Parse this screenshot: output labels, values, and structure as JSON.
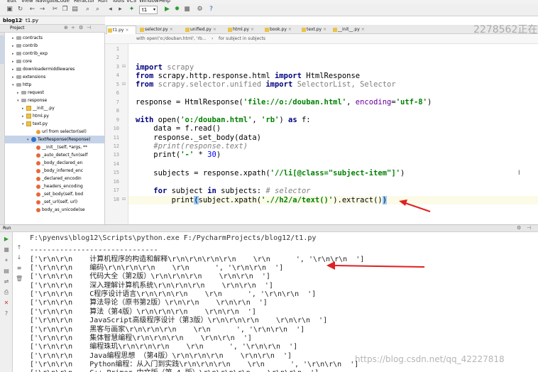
{
  "menu": [
    "Edit",
    "View",
    "Navigate",
    "Code",
    "Refactor",
    "Run",
    "Tools",
    "VCS",
    "Window",
    "Help"
  ],
  "toolbar": {
    "run_config": "t1"
  },
  "breadcrumb": [
    "blog12",
    "t1.py"
  ],
  "project_panel": {
    "title": "Project"
  },
  "tree": [
    {
      "label": "contracts",
      "kind": "folder",
      "indent": 2,
      "arrow": "▸"
    },
    {
      "label": "contrib",
      "kind": "folder",
      "indent": 2,
      "arrow": "▸"
    },
    {
      "label": "contrib_exp",
      "kind": "folder",
      "indent": 2,
      "arrow": "▸"
    },
    {
      "label": "core",
      "kind": "folder",
      "indent": 2,
      "arrow": "▸"
    },
    {
      "label": "downloadermiddlewares",
      "kind": "folder",
      "indent": 2,
      "arrow": "▸"
    },
    {
      "label": "extensions",
      "kind": "folder",
      "indent": 2,
      "arrow": "▸"
    },
    {
      "label": "http",
      "kind": "folder",
      "indent": 2,
      "arrow": "▾"
    },
    {
      "label": "request",
      "kind": "folder",
      "indent": 3,
      "arrow": "▸"
    },
    {
      "label": "response",
      "kind": "folder",
      "indent": 3,
      "arrow": "▾"
    },
    {
      "label": "__init__.py",
      "kind": "py",
      "indent": 4,
      "arrow": "▸"
    },
    {
      "label": "html.py",
      "kind": "py",
      "indent": 4,
      "arrow": "▸"
    },
    {
      "label": "text.py",
      "kind": "py",
      "indent": 4,
      "arrow": "▾"
    },
    {
      "label": "url from selector(sel)",
      "kind": "field",
      "indent": 6,
      "arrow": ""
    },
    {
      "label": "TextResponse(Response)",
      "kind": "class",
      "indent": 5,
      "arrow": "▾",
      "selected": true
    },
    {
      "label": "__init__(self, *args, **",
      "kind": "method",
      "indent": 6,
      "arrow": ""
    },
    {
      "label": "_auto_detect_fun(self",
      "kind": "method",
      "indent": 6,
      "arrow": ""
    },
    {
      "label": "_body_declared_en",
      "kind": "method",
      "indent": 6,
      "arrow": ""
    },
    {
      "label": "_body_inferred_enc",
      "kind": "method",
      "indent": 6,
      "arrow": ""
    },
    {
      "label": "_declared_encodin",
      "kind": "method",
      "indent": 6,
      "arrow": ""
    },
    {
      "label": "_headers_encoding",
      "kind": "method",
      "indent": 6,
      "arrow": ""
    },
    {
      "label": "_set_body(self, bod",
      "kind": "method",
      "indent": 6,
      "arrow": ""
    },
    {
      "label": "_set_url(self, url)",
      "kind": "method",
      "indent": 6,
      "arrow": ""
    },
    {
      "label": "body_as_unicode(se",
      "kind": "method",
      "indent": 6,
      "arrow": ""
    }
  ],
  "tabs": [
    "t1.py",
    "selector.py",
    "unified.py",
    "html.py",
    "book.py",
    "text.py",
    "__init__.py"
  ],
  "editor_breadcrumb": [
    "with open('o:/douban.html', 'rb...",
    "for subject in subjects"
  ],
  "line_numbers": [
    "1",
    "2",
    "3",
    "4",
    "5",
    "6",
    "7",
    "8",
    "9",
    "10",
    "11",
    "12",
    "13",
    "14",
    "15",
    "16",
    "17",
    "18"
  ],
  "code": {
    "l3a": "import",
    "l3b": " scrapy",
    "l4a": "from",
    "l4b": " scrapy.http.response.html ",
    "l4c": "import",
    "l4d": " HtmlResponse",
    "l5a": "from",
    "l5b": " scrapy.selector.unified ",
    "l5c": "import",
    "l5d": " SelectorList, Selector",
    "l7a": "response = HtmlResponse(",
    "l7b": "'file://o:/douban.html'",
    "l7c": ", ",
    "l7d": "encoding",
    "l7e": "=",
    "l7f": "'utf-8'",
    "l7g": ")",
    "l9a": "with",
    "l9b": " open(",
    "l9c": "'o:/douban.html'",
    "l9d": ", ",
    "l9e": "'rb'",
    "l9f": ") ",
    "l9g": "as",
    "l9h": " f:",
    "l10": "    data = f.read()",
    "l11": "    response._set_body(data)",
    "l12": "    #print(response.text)",
    "l13a": "    print(",
    "l13b": "'-'",
    "l13c": " * ",
    "l13d": "30",
    "l13e": ")",
    "l15a": "    subjects = response.xpath(",
    "l15b": "'//li[@class=\"subject-item\"]'",
    "l15c": ")",
    "l17a": "    ",
    "l17b": "for",
    "l17c": " subject ",
    "l17d": "in",
    "l17e": " subjects: ",
    "l17f": "# selector",
    "l18a": "        print",
    "l18b": "(",
    "l18c": "subject.xpath(",
    "l18d": "'.//h2/a/text()'",
    "l18e": ").extract()",
    "l18f": ")"
  },
  "run_panel": {
    "title": "Run"
  },
  "console": [
    "F:\\pyenvs\\blog12\\Scripts\\python.exe F:/PycharmProjects/blog12/t1.py",
    "------------------------------",
    "['\\r\\n\\r\\n    计算机程序的构造和解释\\r\\n\\r\\n\\r\\n\\r\\n    \\r\\n      ', '\\r\\n\\r\\n  ']",
    "['\\r\\n\\r\\n    编码\\r\\n\\r\\n\\r\\n    \\r\\n      ', '\\r\\n\\r\\n  ']",
    "['\\r\\n\\r\\n    代码大全（第2版）\\r\\n\\r\\n\\r\\n    \\r\\n\\r\\n  ']",
    "['\\r\\n\\r\\n    深入理解计算机系统\\r\\n\\r\\n\\r\\n    \\r\\n\\r\\n  ']",
    "['\\r\\n\\r\\n    C程序设计语言\\r\\n\\r\\n\\r\\n    \\r\\n      ', '\\r\\n\\r\\n  ']",
    "['\\r\\n\\r\\n    算法导论（原书第2版）\\r\\n\\r\\n    \\r\\n\\r\\n  ']",
    "['\\r\\n\\r\\n    算法（第4版）\\r\\n\\r\\n\\r\\n    \\r\\n\\r\\n  ']",
    "['\\r\\n\\r\\n    JavaScript高级程序设计（第3版）\\r\\n\\r\\n\\r\\n    \\r\\n\\r\\n  ']",
    "['\\r\\n\\r\\n    黑客与画家\\r\\n\\r\\n\\r\\n    \\r\\n      ', '\\r\\n\\r\\n  ']",
    "['\\r\\n\\r\\n    集体智慧编程\\r\\n\\r\\n\\r\\n    \\r\\n\\r\\n  ']",
    "['\\r\\n\\r\\n    编程珠玑\\r\\n\\r\\n\\r\\n    \\r\\n      ', '\\r\\n\\r\\n  ']",
    "['\\r\\n\\r\\n    Java编程思想 （第4版）\\r\\n\\r\\n\\r\\n    \\r\\n\\r\\n  ']",
    "['\\r\\n\\r\\n    Python编程：从入门到实践\\r\\n\\r\\n\\r\\n    \\r\\n      ', '\\r\\n\\r\\n  ']",
    "['\\r\\n\\r\\n    C++ Primer 中文版（第 4 版）\\r\\n\\r\\n\\r\\n    \\r\\n\\r\\n  ']"
  ],
  "watermarks": [
    "2278562正在",
    "https://blog.csdn.net/qq_42227818"
  ],
  "colors": {
    "arrow": "#e02020",
    "selection": "#c5d3e8",
    "keyword": "#000080",
    "string": "#008000"
  }
}
